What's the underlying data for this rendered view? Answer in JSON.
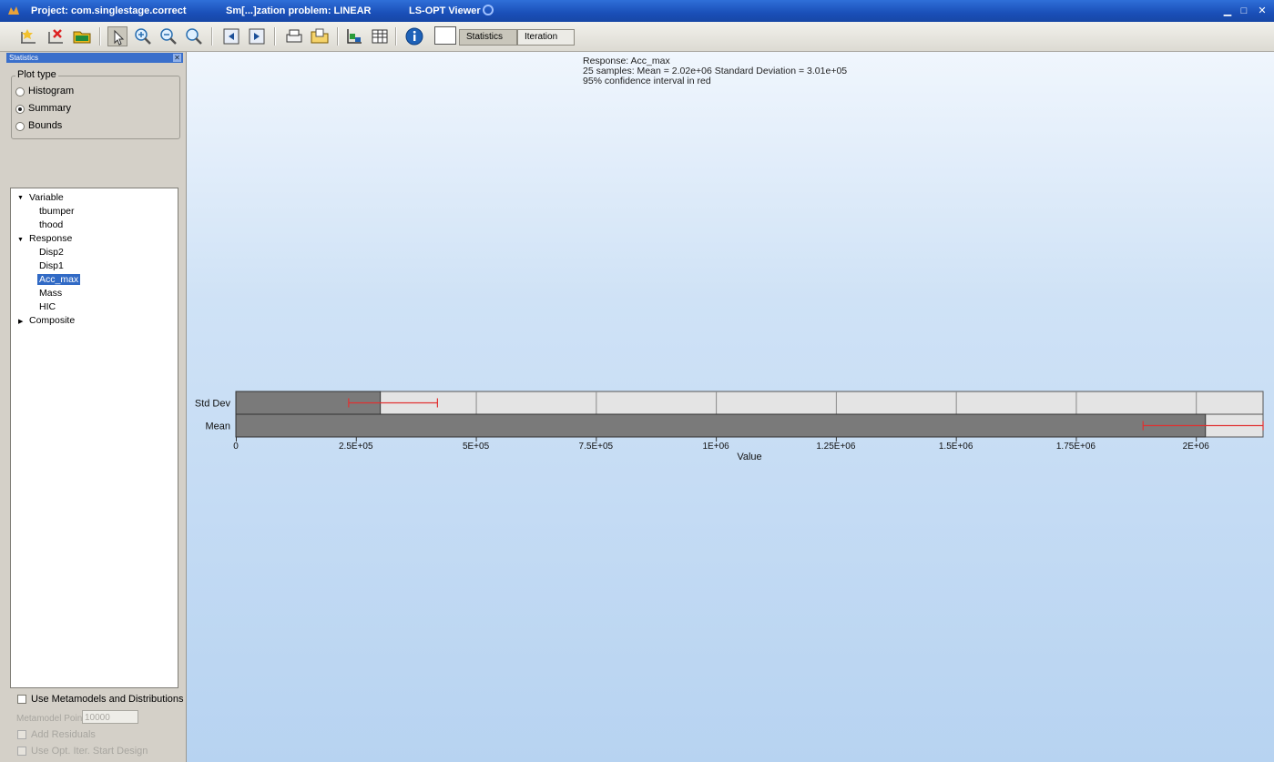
{
  "window": {
    "project_title": "Project: com.singlestage.correct",
    "problem_title": "Sm[...]zation problem: LINEAR",
    "viewer_title": "LS-OPT Viewer"
  },
  "toolbar": {
    "tabs": [
      {
        "label": "Statistics",
        "active": true
      },
      {
        "label": "Iteration",
        "active": false
      }
    ]
  },
  "panel": {
    "header": "Statistics",
    "plot_type": {
      "legend": "Plot type",
      "options": [
        "Histogram",
        "Summary",
        "Bounds"
      ],
      "selected": "Summary"
    },
    "tree": {
      "groups": [
        {
          "label": "Variable",
          "expanded": true,
          "items": [
            "tbumper",
            "thood"
          ]
        },
        {
          "label": "Response",
          "expanded": true,
          "items": [
            "Disp2",
            "Disp1",
            "Acc_max",
            "Mass",
            "HIC"
          ]
        },
        {
          "label": "Composite",
          "expanded": false,
          "items": []
        }
      ],
      "selected": "Acc_max"
    },
    "use_metamodels": "Use Metamodels and Distributions",
    "metamodel_points_label": "Metamodel Points",
    "metamodel_points_value": "10000",
    "add_residuals": "Add Residuals",
    "use_opt_iter": "Use Opt. Iter. Start Design"
  },
  "chart_data": {
    "type": "bar",
    "orientation": "horizontal",
    "title_lines": [
      "Response: Acc_max",
      "25 samples: Mean = 2.02e+06   Standard Deviation = 3.01e+05",
      "95% confidence interval in red"
    ],
    "xlabel": "Value",
    "categories": [
      "Std Dev",
      "Mean"
    ],
    "values": [
      301000,
      2020000
    ],
    "error_intervals": [
      [
        235000,
        420000
      ],
      [
        1890000,
        2140000
      ]
    ],
    "error_color": "#e03030",
    "bar_color": "#7a7a7a",
    "xlim": [
      0,
      2140000
    ],
    "xticks": [
      0,
      250000,
      500000,
      750000,
      1000000,
      1250000,
      1500000,
      1750000,
      2000000
    ],
    "xtick_labels": [
      "0",
      "2.5E+05",
      "5E+05",
      "7.5E+05",
      "1E+06",
      "1.25E+06",
      "1.5E+06",
      "1.75E+06",
      "2E+06"
    ],
    "grid": true
  }
}
